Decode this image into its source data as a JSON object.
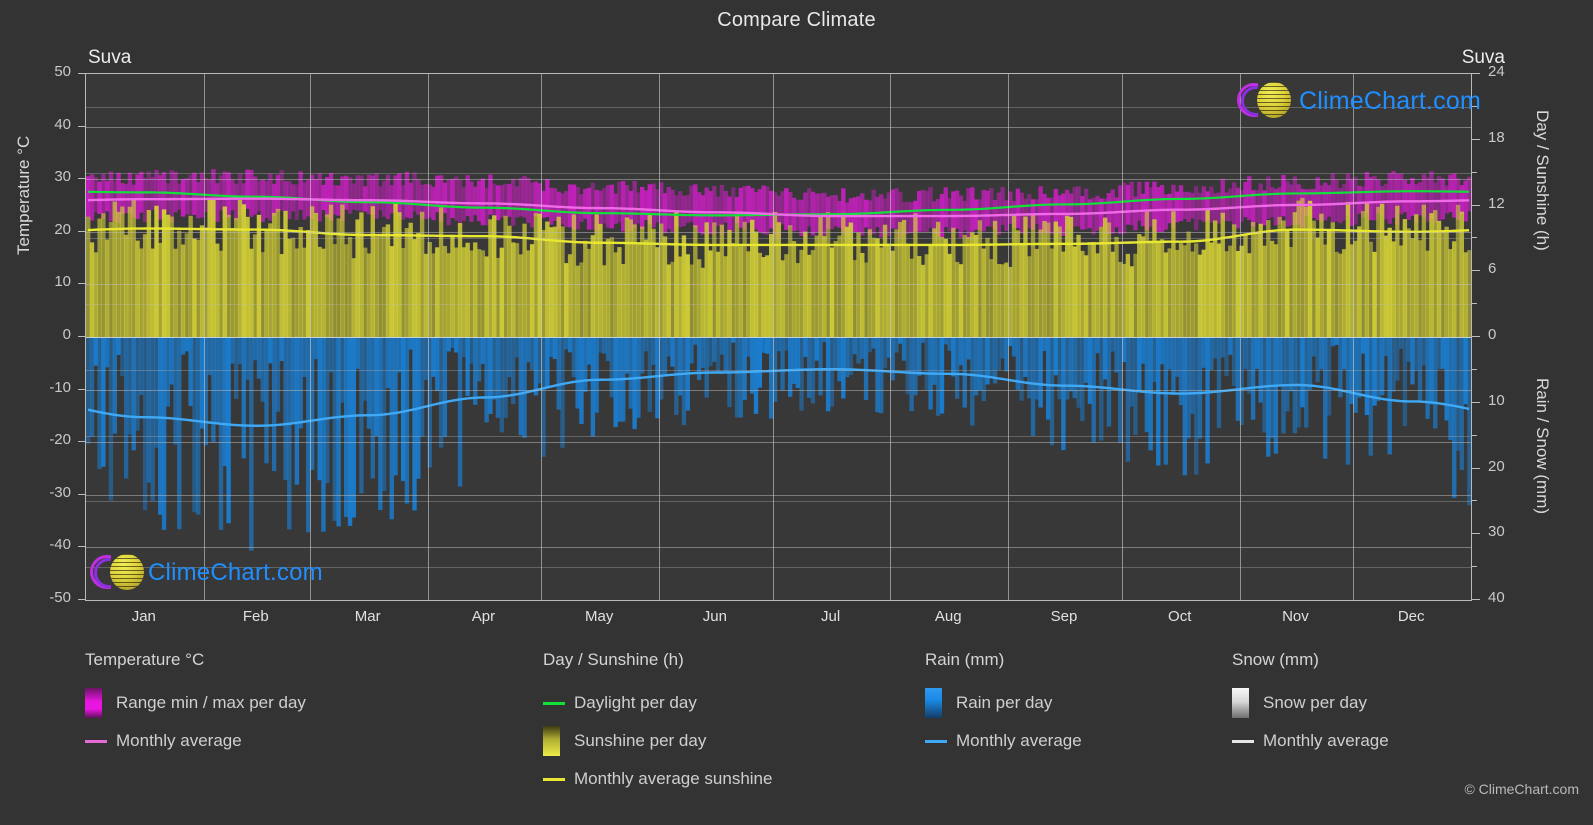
{
  "title": "Compare Climate",
  "city_left": "Suva",
  "city_right": "Suva",
  "copyright": "© ClimeChart.com",
  "logo_text": "ClimeChart.com",
  "axes": {
    "left": {
      "label": "Temperature °C",
      "ticks": [
        "50",
        "40",
        "30",
        "20",
        "10",
        "0",
        "-10",
        "-20",
        "-30",
        "-40",
        "-50"
      ],
      "min": -50,
      "max": 50
    },
    "right_top": {
      "label": "Day / Sunshine (h)",
      "ticks": [
        "24",
        "18",
        "12",
        "6",
        "0"
      ],
      "min": 0,
      "max": 24
    },
    "right_bottom": {
      "label": "Rain / Snow (mm)",
      "ticks": [
        "0",
        "10",
        "20",
        "30",
        "40"
      ],
      "min": 0,
      "max": 40
    },
    "months": [
      "Jan",
      "Feb",
      "Mar",
      "Apr",
      "May",
      "Jun",
      "Jul",
      "Aug",
      "Sep",
      "Oct",
      "Nov",
      "Dec"
    ]
  },
  "legend": {
    "temperature": {
      "header": "Temperature °C",
      "items": [
        {
          "label": "Range min / max per day",
          "type": "box",
          "color": "#e915e0"
        },
        {
          "label": "Monthly average",
          "type": "line",
          "color": "#e36ad8"
        }
      ]
    },
    "day_sunshine": {
      "header": "Day / Sunshine (h)",
      "items": [
        {
          "label": "Daylight per day",
          "type": "line",
          "color": "#12e03a"
        },
        {
          "label": "Sunshine per day",
          "type": "box",
          "color": "#eded4a"
        },
        {
          "label": "Monthly average sunshine",
          "type": "line",
          "color": "#e8e832"
        }
      ]
    },
    "rain": {
      "header": "Rain (mm)",
      "items": [
        {
          "label": "Rain per day",
          "type": "box",
          "color": "#1a8ae5"
        },
        {
          "label": "Monthly average",
          "type": "line",
          "color": "#3fa9f5"
        }
      ]
    },
    "snow": {
      "header": "Snow (mm)",
      "items": [
        {
          "label": "Snow per day",
          "type": "box",
          "color": "#f2f2f2"
        },
        {
          "label": "Monthly average",
          "type": "line",
          "color": "#e6e6e6"
        }
      ]
    }
  },
  "chart_data": {
    "type": "area",
    "title": "Compare Climate",
    "subtitle": "Suva",
    "xlabel": "",
    "ylabel": "Temperature °C",
    "grid": true,
    "legend_position": "bottom",
    "categories": [
      "Jan",
      "Feb",
      "Mar",
      "Apr",
      "May",
      "Jun",
      "Jul",
      "Aug",
      "Sep",
      "Oct",
      "Nov",
      "Dec"
    ],
    "axis_ranges": {
      "temperature_c": [
        -50,
        50
      ],
      "day_sunshine_h": [
        0,
        24
      ],
      "rain_snow_mm": [
        0,
        40
      ]
    },
    "series": [
      {
        "name": "Monthly average temperature (°C)",
        "unit": "°C",
        "color": "#e36ad8",
        "values": [
          26.2,
          26.3,
          26.0,
          25.4,
          24.5,
          23.7,
          23.0,
          23.0,
          23.4,
          24.2,
          25.1,
          25.8
        ]
      },
      {
        "name": "Daily max temperature range top (°C)",
        "unit": "°C",
        "color": "#e915e0",
        "values": [
          30.0,
          30.0,
          29.7,
          29.0,
          28.0,
          27.2,
          26.6,
          26.6,
          27.1,
          28.0,
          29.0,
          29.7
        ]
      },
      {
        "name": "Daily min temperature range bottom (°C)",
        "unit": "°C",
        "color": "#e915e0",
        "values": [
          23.2,
          23.4,
          23.2,
          22.6,
          21.6,
          20.8,
          20.2,
          20.2,
          20.7,
          21.5,
          22.3,
          22.9
        ]
      },
      {
        "name": "Daylight per day (h)",
        "unit": "h",
        "color": "#12e03a",
        "values": [
          13.2,
          12.8,
          12.3,
          11.8,
          11.3,
          11.1,
          11.2,
          11.6,
          12.1,
          12.6,
          13.1,
          13.3
        ]
      },
      {
        "name": "Monthly average sunshine (h)",
        "unit": "h",
        "color": "#e8e832",
        "values": [
          9.9,
          9.8,
          9.3,
          9.2,
          8.6,
          8.4,
          8.4,
          8.4,
          8.5,
          8.7,
          9.8,
          9.6
        ]
      },
      {
        "name": "Rain monthly average (mm/day)",
        "unit": "mm",
        "color": "#3fa9f5",
        "values": [
          12.2,
          13.5,
          11.9,
          9.2,
          6.5,
          5.4,
          4.9,
          5.6,
          7.4,
          8.6,
          7.3,
          9.8
        ]
      }
    ]
  }
}
